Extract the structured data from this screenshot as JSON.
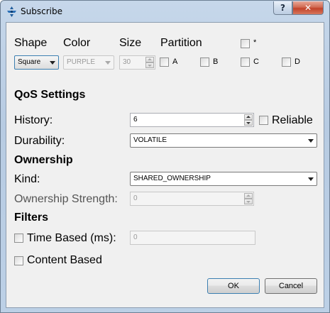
{
  "window": {
    "title": "Subscribe",
    "help_label": "?",
    "close_label": "✕"
  },
  "shape": {
    "label": "Shape",
    "value": "Square"
  },
  "color": {
    "label": "Color",
    "value": "PURPLE"
  },
  "size": {
    "label": "Size",
    "value": "30"
  },
  "partition": {
    "label": "Partition",
    "star_label": "*",
    "options": [
      {
        "label": "A",
        "checked": false
      },
      {
        "label": "B",
        "checked": false
      },
      {
        "label": "C",
        "checked": false
      },
      {
        "label": "D",
        "checked": false
      }
    ]
  },
  "qos": {
    "title": "QoS Settings",
    "history": {
      "label": "History:",
      "value": "6"
    },
    "reliable": {
      "label": "Reliable",
      "checked": false
    },
    "durability": {
      "label": "Durability:",
      "value": "VOLATILE"
    }
  },
  "ownership": {
    "title": "Ownership",
    "kind": {
      "label": "Kind:",
      "value": "SHARED_OWNERSHIP"
    },
    "strength": {
      "label": "Ownership Strength:",
      "value": "0"
    }
  },
  "filters": {
    "title": "Filters",
    "time_based": {
      "label": "Time Based (ms):",
      "value": "0",
      "checked": false
    },
    "content_based": {
      "label": "Content Based",
      "checked": false
    }
  },
  "actions": {
    "ok_label": "OK",
    "cancel_label": "Cancel"
  },
  "colors": {
    "titlebar": "#c6d7ea",
    "client_bg": "#f0f0f0",
    "close_red": "#c2432a"
  }
}
